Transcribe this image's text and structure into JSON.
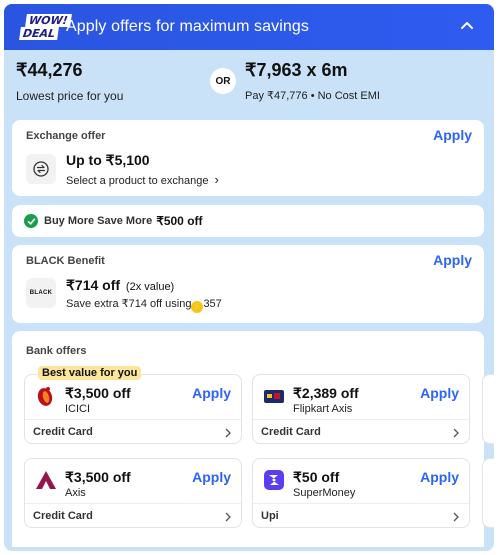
{
  "header": {
    "badge_line1": "WOW!",
    "badge_line2": "DEAL",
    "title": "Apply offers for maximum savings",
    "collapse_icon": "chevron-up-icon"
  },
  "pricing": {
    "lowest_price": "₹44,276",
    "lowest_label": "Lowest price for you",
    "or_label": "OR",
    "emi_price": "₹7,963 x 6m",
    "emi_label": "Pay ₹47,776 • No Cost EMI"
  },
  "exchange": {
    "title": "Exchange offer",
    "apply": "Apply",
    "amount": "Up to ₹5,100",
    "description": "Select a product to exchange",
    "chevron": "›",
    "icon": "exchange-icon"
  },
  "buy_more": {
    "label": "Buy More Save More",
    "value": "₹500 off",
    "icon": "check-circle-icon"
  },
  "black": {
    "title": "BLACK Benefit",
    "apply": "Apply",
    "logo_text": "BLACK",
    "amount": "₹714 off",
    "multiplier": "(2x value)",
    "save_text": "Save extra ₹714 off using",
    "coins": "357"
  },
  "bank": {
    "title": "Bank offers",
    "best_tag": "Best value for you",
    "offers": [
      {
        "amount": "₹3,500 off",
        "bank": "ICICI",
        "apply": "Apply",
        "type": "Credit Card",
        "chevron": "›"
      },
      {
        "amount": "₹2,389 off",
        "bank": "Flipkart Axis",
        "apply": "Apply",
        "type": "Credit Card",
        "chevron": "›"
      },
      {
        "amount": "₹3,500 off",
        "bank": "Axis",
        "apply": "Apply",
        "type": "Credit Card",
        "chevron": "›"
      },
      {
        "amount": "₹50 off",
        "bank": "SuperMoney",
        "apply": "Apply",
        "type": "Upi",
        "chevron": "›"
      }
    ]
  },
  "colors": {
    "header_blue": "#2f5cf0",
    "panel_bg": "#c9e2f7",
    "apply_blue": "#2c64f5",
    "green": "#1a9e4b",
    "best_tag_bg": "#fce69a"
  }
}
